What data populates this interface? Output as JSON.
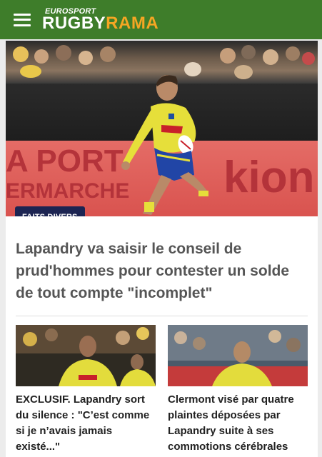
{
  "header": {
    "brand_top": "EUROSPORT",
    "brand_main_a": "RUGBY",
    "brand_main_b": "RAMA",
    "menu_icon": "hamburger-menu-icon",
    "colors": {
      "bar": "#3e7d2a",
      "accent": "#f5a623"
    }
  },
  "hero": {
    "category": "FAITS DIVERS",
    "title": "Lapandry va saisir le conseil de prud'hommes pour contester un solde de tout compte \"incomplet\"",
    "ad_text_left": "A PORT",
    "ad_text_left2": "ERMARCHE",
    "ad_text_right": "kion"
  },
  "related": [
    {
      "title": "EXCLUSIF. Lapandry sort du silence : \"C’est comme si je n’avais jamais existé...\""
    },
    {
      "title": "Clermont visé par quatre plaintes déposées par Lapandry suite à ses commotions cérébrales"
    }
  ]
}
